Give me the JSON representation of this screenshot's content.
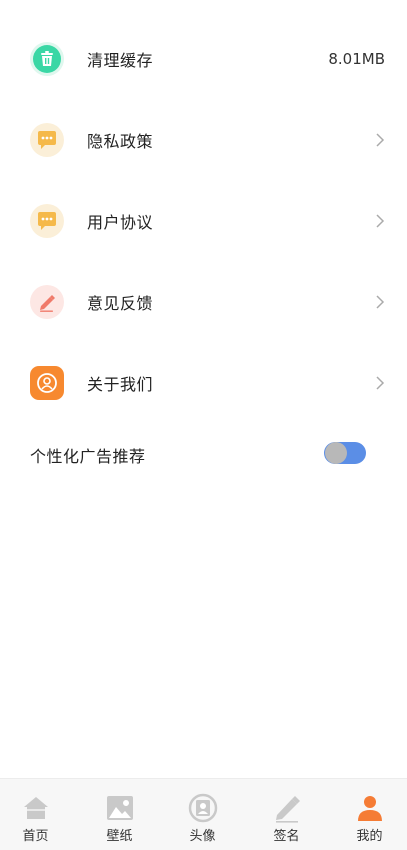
{
  "settings": {
    "items": [
      {
        "label": "清理缓存",
        "value": "8.01MB",
        "icon": "trash-icon",
        "icon_color": "#3ad7a5"
      },
      {
        "label": "隐私政策",
        "icon": "chat-bubble-icon",
        "icon_color": "#f5b94a"
      },
      {
        "label": "用户协议",
        "icon": "chat-bubble-icon",
        "icon_color": "#f5b94a"
      },
      {
        "label": "意见反馈",
        "icon": "pen-icon",
        "icon_color": "#f07a6a"
      },
      {
        "label": "关于我们",
        "icon": "user-circle-icon",
        "icon_color": "#f7892f"
      }
    ],
    "ad_toggle": {
      "label": "个性化广告推荐",
      "track_color": "#5b8ee6"
    }
  },
  "tabbar": {
    "active_color": "#f57c35",
    "inactive_color": "#c9c9c9",
    "tabs": [
      {
        "label": "首页",
        "icon": "home-icon"
      },
      {
        "label": "壁纸",
        "icon": "image-icon"
      },
      {
        "label": "头像",
        "icon": "avatar-icon"
      },
      {
        "label": "签名",
        "icon": "pen-icon"
      },
      {
        "label": "我的",
        "icon": "user-icon",
        "active": true
      }
    ]
  }
}
